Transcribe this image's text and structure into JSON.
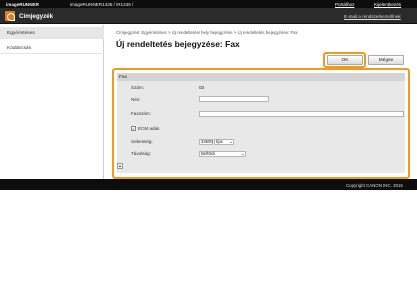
{
  "topbar": {
    "brand": "imageRUNNER",
    "model": "imageRUNNER1435 / iR1435 /",
    "portal": "Portálhoz",
    "logout": "Kijelentkezés"
  },
  "titlebar": {
    "app_title": "Címjegyzék",
    "mail_link": "E-mail a rendszerkezelőnek"
  },
  "sidebar": {
    "items": [
      {
        "label": "Egyérintéses"
      },
      {
        "label": "Kódtárcsás"
      }
    ]
  },
  "main": {
    "breadcrumb": "Címjegyzék: Egyérintéses > Új rendeltetési hely bejegyzése > Új rendeltetés bejegyzése: Fax",
    "title": "Új rendeltetés bejegyzése: Fax",
    "ok_label": "OK",
    "cancel_label": "Mégse"
  },
  "form": {
    "section_title": "Fax",
    "number_label": "Szám:",
    "number_value": "03",
    "name_label": "Név:",
    "name_value": "",
    "fax_label": "Faxszám:",
    "fax_value": "",
    "ecm_label": "ECM adás",
    "ecm_checked": true,
    "speed_label": "Sebesség:",
    "speed_value": "33600",
    "speed_unit": "bps",
    "distance_label": "Távolság:",
    "distance_value": "Belföldi"
  },
  "footer": {
    "copyright": "Copyright CANON INC. 2015"
  },
  "colors": {
    "highlight": "#f29a1e",
    "header_bg": "#2b2b2b",
    "top_bg": "#0d0d0d"
  }
}
